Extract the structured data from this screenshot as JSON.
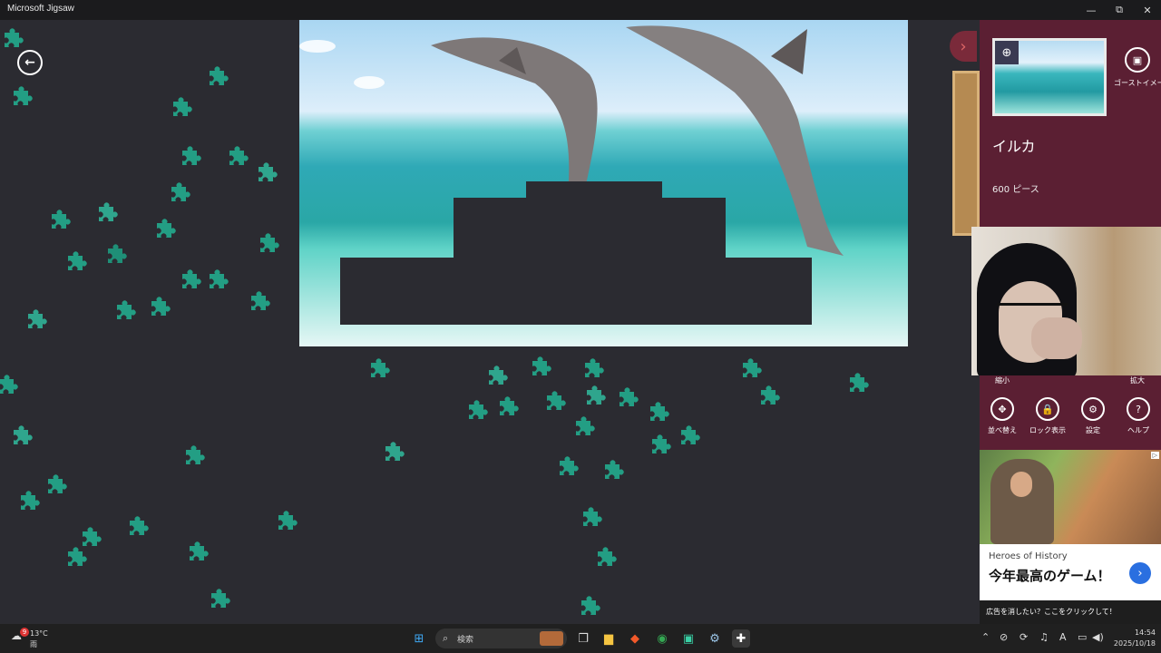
{
  "window": {
    "title": "Microsoft Jigsaw"
  },
  "window_controls": {
    "minimize": "—",
    "maximize": "⧉",
    "close": "✕"
  },
  "board": {
    "back_icon": "arrow-left-icon"
  },
  "panel": {
    "ghost_image_label": "ゴーストイメージ",
    "puzzle_name": "イルカ",
    "piece_count": "600 ピース",
    "zoom_out_label": "縮小",
    "zoom_in_label": "拡大",
    "tools": [
      {
        "label": "並べ替え",
        "icon": "shuffle-icon"
      },
      {
        "label": "ロック表示",
        "icon": "lock-icon"
      },
      {
        "label": "設定",
        "icon": "gear-icon"
      },
      {
        "label": "ヘルプ",
        "icon": "help-icon"
      }
    ]
  },
  "ad": {
    "brand": "Heroes of History",
    "headline": "今年最高のゲーム！",
    "remove_ads": "広告を消したい？ここをクリックして！",
    "ad_tag": "▷"
  },
  "taskbar": {
    "weather_temp": "13°C",
    "weather_cond": "雨",
    "weather_badge": "9",
    "search_placeholder": "検索",
    "time": "14:54",
    "date": "2025/10/18"
  },
  "colors": {
    "board_bg": "#2b2b31",
    "panel_bg": "#5b1f33",
    "piece": "#239e84",
    "taskbar_bg": "#202020"
  }
}
